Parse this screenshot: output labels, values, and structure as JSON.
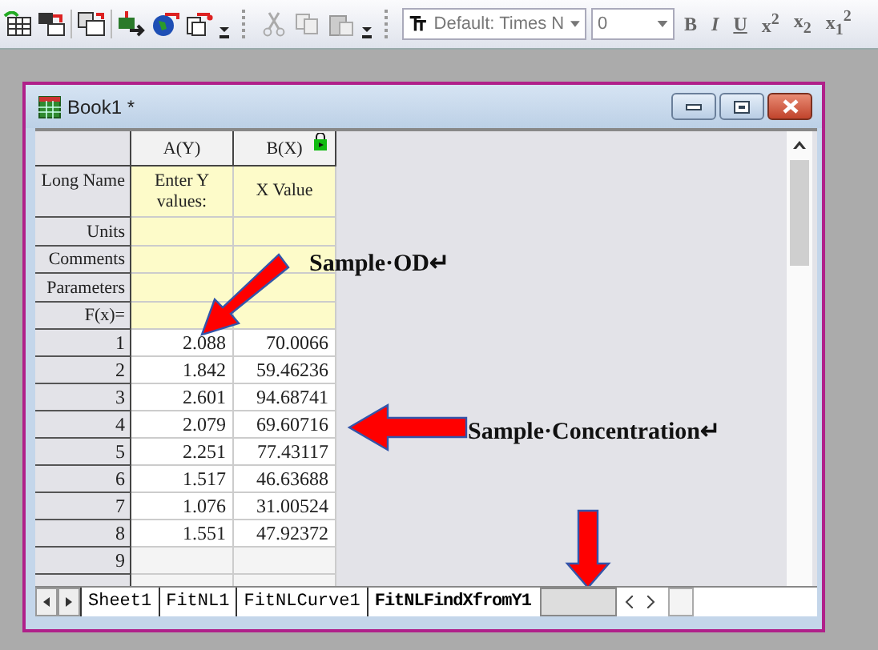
{
  "toolbar": {
    "font": "Default: Times N",
    "size": "0",
    "format_buttons": [
      "B",
      "I",
      "U",
      "x$^{2}$",
      "x$_{2}$",
      "x$_{1}$$^{2}$"
    ]
  },
  "window": {
    "title": "Book1 *"
  },
  "table": {
    "columns": [
      "A(Y)",
      "B(X)"
    ],
    "label_rows": [
      {
        "label": "Long Name",
        "cells": [
          "Enter Y values:",
          "X Value"
        ]
      },
      {
        "label": "Units",
        "cells": [
          "",
          ""
        ]
      },
      {
        "label": "Comments",
        "cells": [
          "",
          ""
        ]
      },
      {
        "label": "Parameters",
        "cells": [
          "",
          ""
        ]
      },
      {
        "label": "F(x)=",
        "cells": [
          "",
          ""
        ]
      }
    ],
    "rows": [
      {
        "index": "1",
        "cells": [
          "2.088",
          "70.0066"
        ]
      },
      {
        "index": "2",
        "cells": [
          "1.842",
          "59.46236"
        ]
      },
      {
        "index": "3",
        "cells": [
          "2.601",
          "94.68741"
        ]
      },
      {
        "index": "4",
        "cells": [
          "2.079",
          "69.60716"
        ]
      },
      {
        "index": "5",
        "cells": [
          "2.251",
          "77.43117"
        ]
      },
      {
        "index": "6",
        "cells": [
          "1.517",
          "46.63688"
        ]
      },
      {
        "index": "7",
        "cells": [
          "1.076",
          "31.00524"
        ]
      },
      {
        "index": "8",
        "cells": [
          "1.551",
          "47.92372"
        ]
      },
      {
        "index": "9",
        "cells": [
          "",
          ""
        ]
      }
    ]
  },
  "sheet_tabs": [
    {
      "label": "Sheet1",
      "selected": false
    },
    {
      "label": "FitNL1",
      "selected": false
    },
    {
      "label": "FitNLCurve1",
      "selected": false
    },
    {
      "label": "FitNLFindXfromY1",
      "selected": true
    }
  ],
  "annotations": [
    {
      "text": "Sample·OD↵"
    },
    {
      "text": "Sample·Concentration↵"
    }
  ]
}
